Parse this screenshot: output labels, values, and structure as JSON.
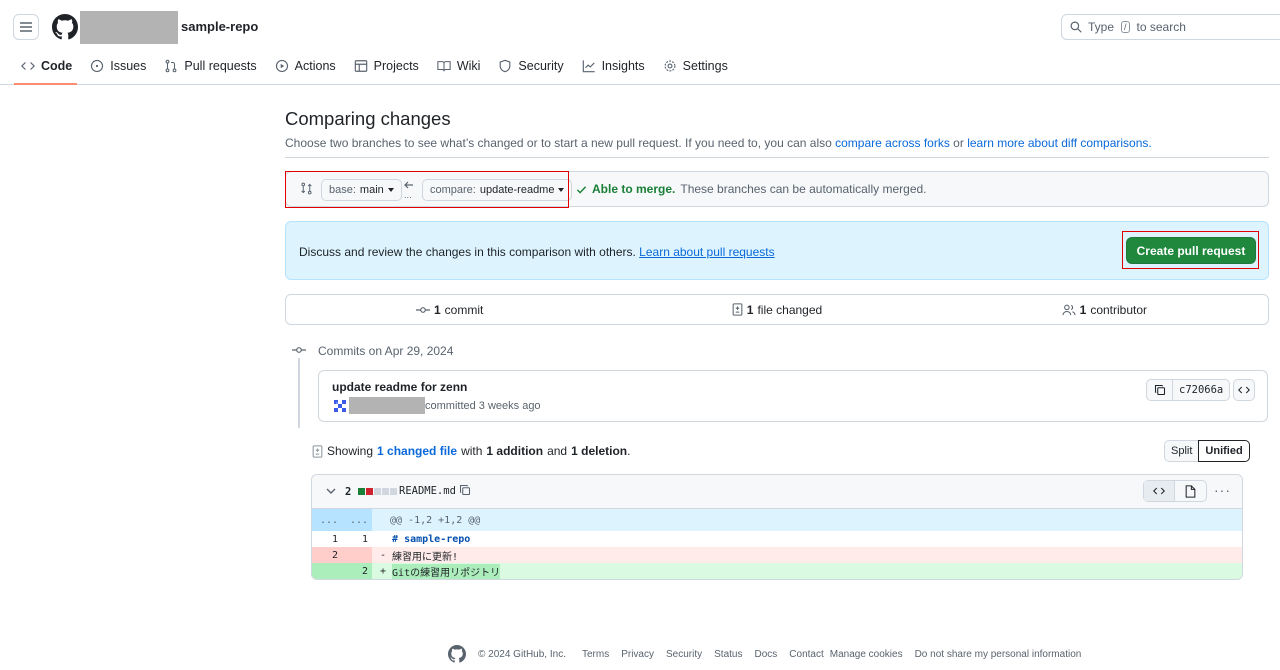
{
  "header": {
    "repo_name": "sample-repo",
    "search_prefix": "Type",
    "search_key": "/",
    "search_suffix": "to search"
  },
  "tabs": [
    {
      "label": "Code",
      "icon": "code-icon",
      "active": true
    },
    {
      "label": "Issues",
      "icon": "issue-icon"
    },
    {
      "label": "Pull requests",
      "icon": "pull-request-icon"
    },
    {
      "label": "Actions",
      "icon": "play-icon"
    },
    {
      "label": "Projects",
      "icon": "table-icon"
    },
    {
      "label": "Wiki",
      "icon": "book-icon"
    },
    {
      "label": "Security",
      "icon": "shield-icon"
    },
    {
      "label": "Insights",
      "icon": "graph-icon"
    },
    {
      "label": "Settings",
      "icon": "gear-icon"
    }
  ],
  "compare": {
    "title": "Comparing changes",
    "subtitle_prefix": "Choose two branches to see what’s changed or to start a new pull request. If you need to, you can also",
    "link_forks": "compare across forks",
    "subtitle_or": "or",
    "link_learn": "learn more about diff comparisons.",
    "base_label": "base:",
    "base_value": "main",
    "compare_label": "compare:",
    "compare_value": "update-readme",
    "merge_ok": "Able to merge.",
    "merge_text": "These branches can be automatically merged."
  },
  "blankslate": {
    "text": "Discuss and review the changes in this comparison with others.",
    "link": "Learn about pull requests",
    "button": "Create pull request"
  },
  "stats": {
    "commits_count": "1",
    "commits_label": "commit",
    "files_count": "1",
    "files_label": "file changed",
    "contributors_count": "1",
    "contributors_label": "contributor"
  },
  "commits": {
    "heading": "Commits on Apr 29, 2024",
    "title": "update readme for zenn",
    "meta": "committed 3 weeks ago",
    "sha": "c72066a"
  },
  "summary": {
    "showing": "Showing",
    "changed_link": "1 changed file",
    "with": "with",
    "additions": "1 addition",
    "and": "and",
    "deletions": "1 deletion",
    "period": ".",
    "split": "Split",
    "unified": "Unified"
  },
  "file": {
    "count": "2",
    "name": "README.md",
    "hunk_l": "...",
    "hunk_r": "...",
    "hunk": "@@ -1,2 +1,2 @@",
    "lines": [
      {
        "type": "ctx",
        "old": "1",
        "new": "1",
        "sign": " ",
        "text": "# sample-repo"
      },
      {
        "type": "del",
        "old": "2",
        "new": "",
        "sign": "-",
        "text": "練習用に更新!"
      },
      {
        "type": "add",
        "old": "",
        "new": "2",
        "sign": "+",
        "text": "Gitの練習用リポジトリ"
      }
    ]
  },
  "footer": {
    "copyright": "© 2024 GitHub, Inc.",
    "links": [
      "Terms",
      "Privacy",
      "Security",
      "Status",
      "Docs",
      "Contact",
      "Manage cookies",
      "Do not share my personal information"
    ]
  },
  "colors": {
    "accent": "#0969da",
    "success": "#1f883d",
    "highlight_outline": "#e00000"
  }
}
